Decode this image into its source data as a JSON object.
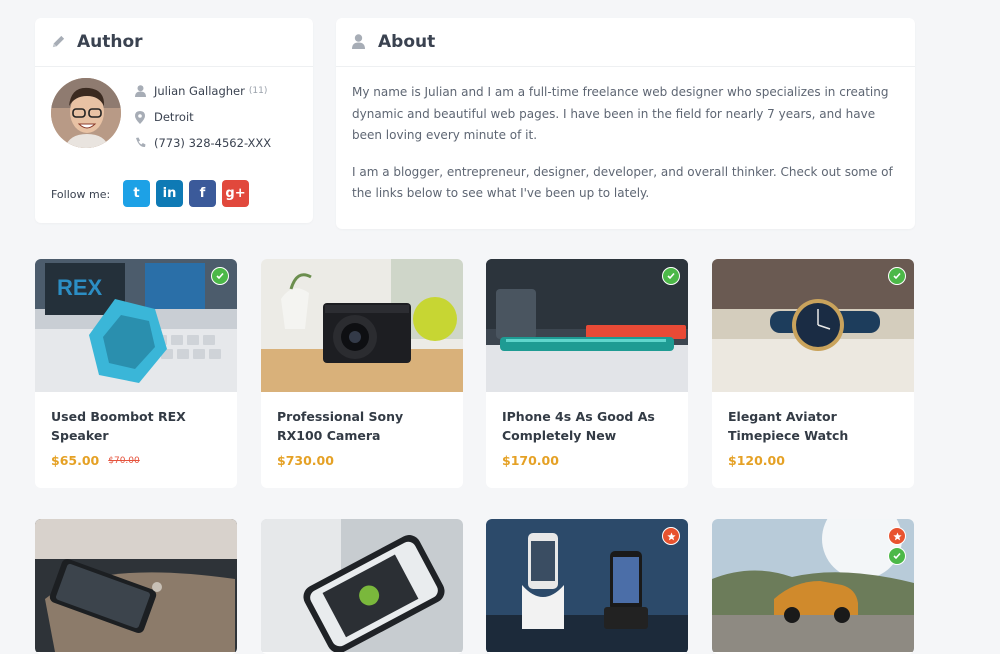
{
  "author": {
    "title": "Author",
    "name": "Julian Gallagher",
    "count": "(11)",
    "location": "Detroit",
    "phone": "(773) 328-4562-XXX",
    "follow_label": "Follow me:",
    "socials": [
      {
        "icon": "twitter-icon",
        "glyph": "t",
        "color": "#1da1e6"
      },
      {
        "icon": "linkedin-icon",
        "glyph": "in",
        "color": "#0e7ab5"
      },
      {
        "icon": "facebook-icon",
        "glyph": "f",
        "color": "#3b5a9a"
      },
      {
        "icon": "google-plus-icon",
        "glyph": "g+",
        "color": "#e1483c"
      }
    ]
  },
  "about": {
    "title": "About",
    "paragraphs": [
      "My name is Julian and I am a full-time freelance web designer who specializes in creating dynamic and beautiful web pages. I have been in the field for nearly 7 years, and have been loving every minute of it.",
      "I am a blogger, entrepreneur, designer, developer, and overall thinker. Check out some of the links below to see what I've been up to lately."
    ]
  },
  "products": [
    {
      "name": "Used Boombot REX Speaker",
      "price": "$65.00",
      "old_price": "$70.00",
      "badges": [
        "check"
      ]
    },
    {
      "name": "Professional Sony RX100 Camera",
      "price": "$730.00",
      "old_price": "",
      "badges": []
    },
    {
      "name": "IPhone 4s As Good As Completely New",
      "price": "$170.00",
      "old_price": "",
      "badges": [
        "check"
      ]
    },
    {
      "name": "Elegant Aviator Timepiece Watch",
      "price": "$120.00",
      "old_price": "",
      "badges": [
        "check"
      ]
    },
    {
      "name": "",
      "price": "",
      "old_price": "",
      "badges": []
    },
    {
      "name": "",
      "price": "",
      "old_price": "",
      "badges": []
    },
    {
      "name": "",
      "price": "",
      "old_price": "",
      "badges": [
        "star"
      ]
    },
    {
      "name": "",
      "price": "",
      "old_price": "",
      "badges": [
        "star",
        "check"
      ]
    }
  ],
  "colors": {
    "price": "#e5a125",
    "old_price": "#e5533d",
    "check_badge": "#4cb848",
    "star_badge": "#e8532f"
  }
}
